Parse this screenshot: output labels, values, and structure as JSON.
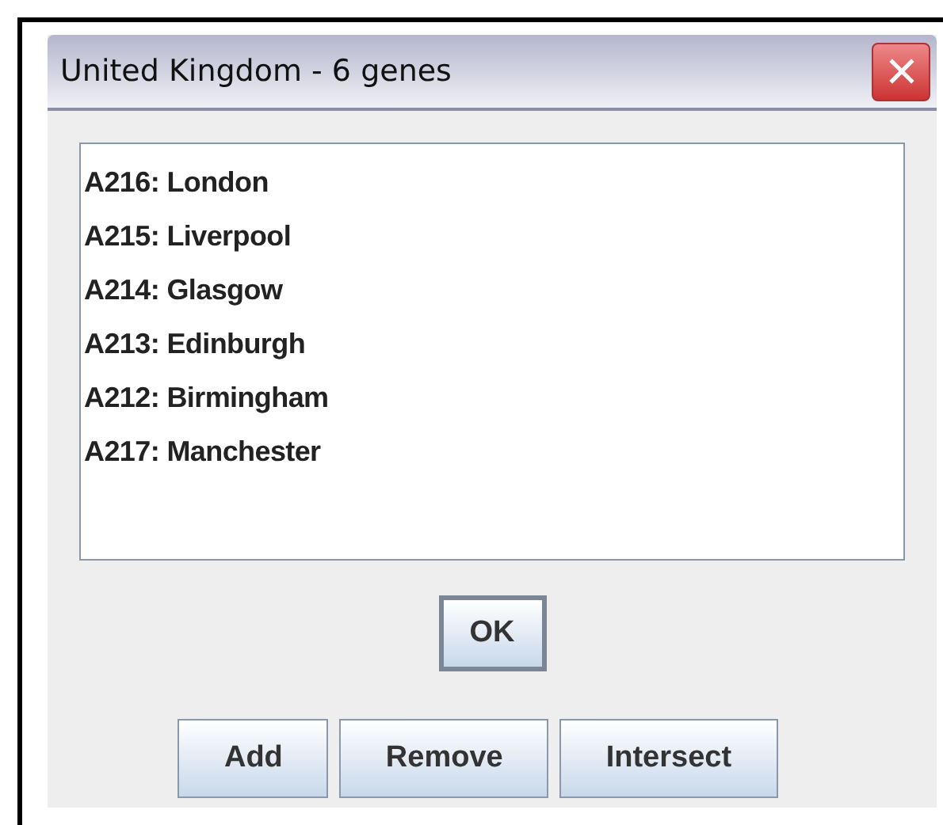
{
  "window": {
    "title": "United Kingdom - 6 genes"
  },
  "list": {
    "items": [
      {
        "label": "A216: London"
      },
      {
        "label": "A215: Liverpool"
      },
      {
        "label": "A214: Glasgow"
      },
      {
        "label": "A213: Edinburgh"
      },
      {
        "label": "A212: Birmingham"
      },
      {
        "label": "A217: Manchester"
      }
    ]
  },
  "ok_button": {
    "label": "OK",
    "focused": true
  },
  "buttons": [
    {
      "label": "Add"
    },
    {
      "label": "Remove"
    },
    {
      "label": "Intersect"
    }
  ]
}
